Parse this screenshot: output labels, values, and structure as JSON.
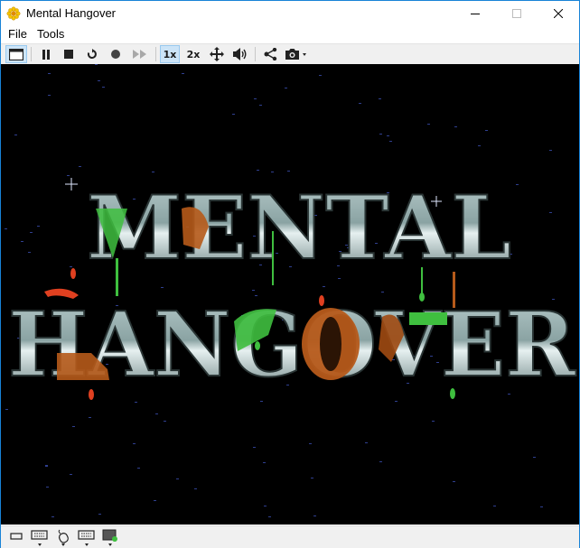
{
  "window": {
    "title": "Mental Hangover"
  },
  "menu": {
    "items": [
      "File",
      "Tools"
    ]
  },
  "toolbar": {
    "icons": [
      "window-mode-icon",
      "pause-icon",
      "stop-icon",
      "reset-icon",
      "record-icon",
      "fast-forward-icon",
      "zoom-1x",
      "zoom-2x",
      "fullscreen-icon",
      "volume-icon",
      "share-icon",
      "screenshot-icon"
    ],
    "zoom_1x_label": "1x",
    "zoom_2x_label": "2x",
    "active_zoom": "1x"
  },
  "game": {
    "title_line1": "MENTAL",
    "title_line2": "HANGOVER",
    "colors": {
      "background": "#000000",
      "metal": "#8fa8a8",
      "rust": "#b65a1a",
      "slime": "#3fbf3f"
    }
  },
  "statusbar": {
    "icons": [
      "floppy-drive-icon",
      "keyboard-icon",
      "mouse-icon",
      "keyboard-alt-icon",
      "monitor-icon"
    ]
  },
  "colors": {
    "accent": "#1883d7",
    "toolbar_active": "#cce4f7"
  }
}
